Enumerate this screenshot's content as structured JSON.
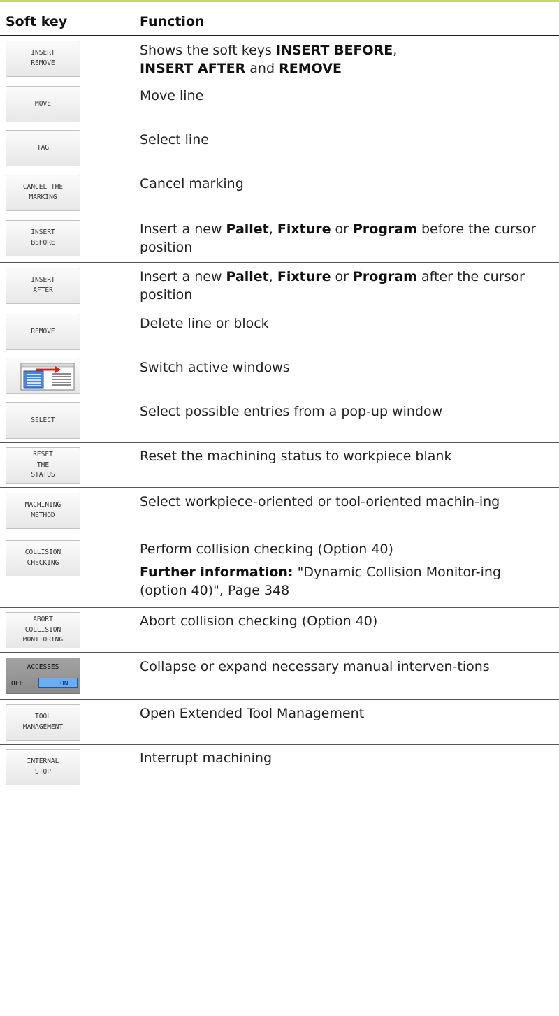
{
  "table": {
    "col_softkey": "Soft key",
    "col_function": "Function"
  },
  "rows": [
    {
      "softkey": [
        "INSERT",
        "REMOVE"
      ],
      "fn": {
        "pre": "Shows the soft keys ",
        "b1": "INSERT BEFORE",
        "mid1": ",",
        "b2": "INSERT AFTER",
        "mid2": " and ",
        "b3": "REMOVE"
      }
    },
    {
      "softkey": [
        "MOVE"
      ],
      "text": "Move line"
    },
    {
      "softkey": [
        "TAG"
      ],
      "text": "Select line"
    },
    {
      "softkey": [
        "CANCEL THE",
        "MARKING"
      ],
      "text": "Cancel marking"
    },
    {
      "softkey": [
        "INSERT",
        "BEFORE"
      ],
      "fn": {
        "pre": "Insert a new ",
        "b1": "Pallet",
        "mid1": ", ",
        "b2": "Fixture",
        "mid2": " or ",
        "b3": "Program",
        "post": " before the cursor position"
      }
    },
    {
      "softkey": [
        "INSERT",
        "AFTER"
      ],
      "fn": {
        "pre": "Insert a new ",
        "b1": "Pallet",
        "mid1": ", ",
        "b2": "Fixture",
        "mid2": " or ",
        "b3": "Program",
        "post": " after the cursor position"
      }
    },
    {
      "softkey": [
        "REMOVE"
      ],
      "text": "Delete line or block"
    },
    {
      "softkey_icon": "switch-windows-icon",
      "text": "Switch active windows"
    },
    {
      "softkey": [
        "SELECT"
      ],
      "text": "Select possible entries from a pop-up window"
    },
    {
      "softkey": [
        "RESET",
        "THE",
        "STATUS"
      ],
      "text": "Reset the machining status to workpiece blank"
    },
    {
      "softkey": [
        "MACHINING",
        "METHOD"
      ],
      "text": "Select workpiece-oriented or tool-oriented machin-ing"
    },
    {
      "softkey": [
        "COLLISION",
        "CHECKING"
      ],
      "text": "Perform collision checking (Option 40)",
      "further": {
        "label": "Further information:",
        "link": " \"Dynamic Collision Monitor-ing (option 40)\", Page 348"
      }
    },
    {
      "softkey": [
        "ABORT",
        "COLLISION",
        "MONITORING"
      ],
      "text": "Abort collision checking (Option 40)"
    },
    {
      "softkey_toggle": {
        "title": "ACCESSES",
        "off": "OFF",
        "on": "ON"
      },
      "text": "Collapse or expand necessary manual interven-tions"
    },
    {
      "softkey": [
        "TOOL",
        "MANAGEMENT"
      ],
      "text": "Open Extended Tool Management"
    },
    {
      "softkey": [
        "INTERNAL",
        "STOP"
      ],
      "text": "Interrupt machining"
    }
  ],
  "colors": {
    "accent_line": "#c8d66e",
    "toggle_on": "#6aaef0"
  }
}
